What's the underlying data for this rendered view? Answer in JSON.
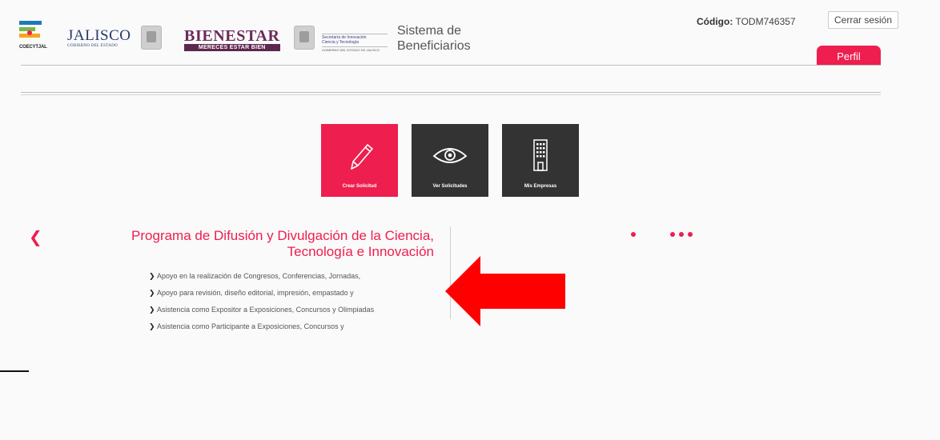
{
  "header": {
    "logos": {
      "coecytjal": "COECYTJAL",
      "jalisco": "JALISCO",
      "jalisco_sub": "GOBIERNO DEL ESTADO",
      "bienestar": "BIENESTAR",
      "bienestar_tag": "MERECES ESTAR BIEN",
      "sicyt_line1": "Secretaría de Innovación",
      "sicyt_line2": "Ciencia y Tecnología",
      "sicyt_line3": "GOBIERNO DEL ESTADO DE JALISCO"
    },
    "system_title_line1": "Sistema de",
    "system_title_line2": "Beneficiarios",
    "codigo_label": "Código:",
    "codigo_value": "TODM746357",
    "logout_label": "Cerrar sesión",
    "profile_tab": "Perfil"
  },
  "actions": [
    {
      "label": "Crear Solicitud",
      "icon": "pencil-icon",
      "color": "#ee1e4f"
    },
    {
      "label": "Ver Solicitudes",
      "icon": "eye-icon",
      "color": "#333333"
    },
    {
      "label": "Mis Empresas",
      "icon": "building-icon",
      "color": "#333333"
    }
  ],
  "program": {
    "prev_icon": "chevron-left-icon",
    "title_line1": "Programa de Difusión y Divulgación de la Ciencia,",
    "title_line2": "Tecnología e Innovación",
    "items": [
      "Apoyo en la realización de Congresos, Conferencias, Jornadas,",
      "Apoyo para revisión, diseño editorial, impresión, empastado y",
      "Asistencia como Expositor a Exposiciones, Concursos y Olimpiadas",
      "Asistencia como Participante a Exposiciones, Concursos y"
    ]
  },
  "annotation": {
    "arrow_icon": "left-pointing-arrow",
    "arrow_color": "#ff0000"
  },
  "colors": {
    "accent": "#ee1e4f",
    "tile_dark": "#333333"
  }
}
